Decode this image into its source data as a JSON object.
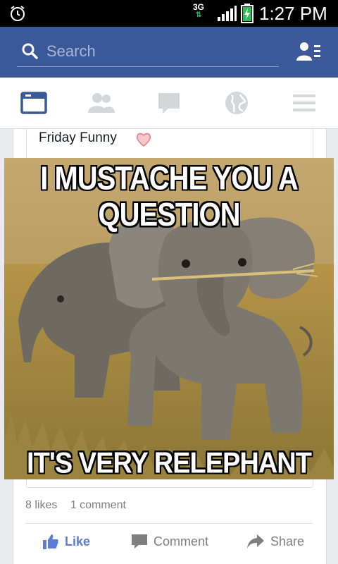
{
  "status_bar": {
    "network": "3G",
    "time": "1:27 PM",
    "icons": [
      "alarm-icon",
      "signal-icon",
      "battery-charging-icon"
    ]
  },
  "header": {
    "search_placeholder": "Search",
    "search_icon": "search-icon",
    "friend_requests_icon": "friend-requests-icon"
  },
  "nav": {
    "items": [
      {
        "name": "news-feed",
        "icon": "news-feed-icon",
        "active": true
      },
      {
        "name": "friends",
        "icon": "friends-icon",
        "active": false
      },
      {
        "name": "messages",
        "icon": "chat-bubble-icon",
        "active": false
      },
      {
        "name": "notifications",
        "icon": "globe-icon",
        "active": false
      },
      {
        "name": "more",
        "icon": "menu-icon",
        "active": false
      }
    ],
    "active_color": "#3b5998",
    "inactive_color": "#d4d6da"
  },
  "post": {
    "text": "Friday Funny",
    "emoji": "heart-icon",
    "meme": {
      "top_caption": "I MUSTACHE YOU A QUESTION",
      "bottom_caption": "IT'S VERY RELEPHANT"
    },
    "likes": "8 likes",
    "comments": "1 comment",
    "actions": {
      "like": "Like",
      "comment": "Comment",
      "share": "Share"
    }
  },
  "colors": {
    "brand": "#3b5998",
    "like_blue": "#5b7bd5",
    "muted": "#7f7f7f"
  }
}
